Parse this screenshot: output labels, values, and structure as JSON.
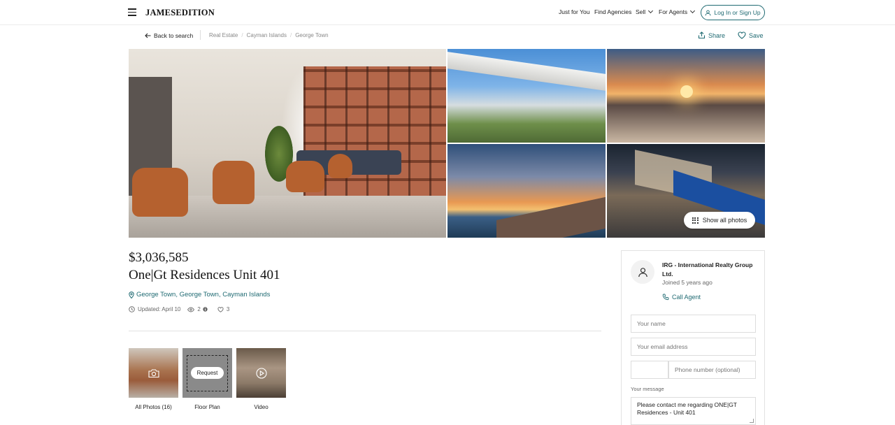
{
  "header": {
    "logo": "JAMESEDITION",
    "nav": {
      "just_for_you": "Just for You",
      "find_agencies": "Find Agencies",
      "sell": "Sell",
      "for_agents": "For Agents"
    },
    "login_label": "Log In or Sign Up"
  },
  "breadcrumb": {
    "back_label": "Back to search",
    "items": [
      "Real Estate",
      "Cayman Islands",
      "George Town"
    ],
    "share_label": "Share",
    "save_label": "Save"
  },
  "gallery": {
    "show_all_label": "Show all photos"
  },
  "listing": {
    "price": "$3,036,585",
    "title": "One|Gt Residences Unit 401",
    "location": "George Town, George Town, Cayman Islands",
    "updated": "Updated: April 10",
    "views": "2",
    "likes": "3"
  },
  "media": {
    "items": [
      {
        "label": "All Photos (16)"
      },
      {
        "label": "Floor Plan",
        "overlay": "Request"
      },
      {
        "label": "Video"
      }
    ]
  },
  "agent": {
    "name": "IRG - International Realty Group Ltd.",
    "joined": "Joined 5 years ago",
    "call_label": "Call Agent",
    "form": {
      "name_placeholder": "Your name",
      "email_placeholder": "Your email address",
      "phone_placeholder": "Phone number (optional)",
      "message_label": "Your message",
      "message_value": "Please contact me regarding ONE|GT Residences - Unit 401"
    }
  },
  "colors": {
    "accent": "#1f6a72",
    "text": "#222222",
    "muted": "#888888",
    "border": "#e2e2e2"
  }
}
